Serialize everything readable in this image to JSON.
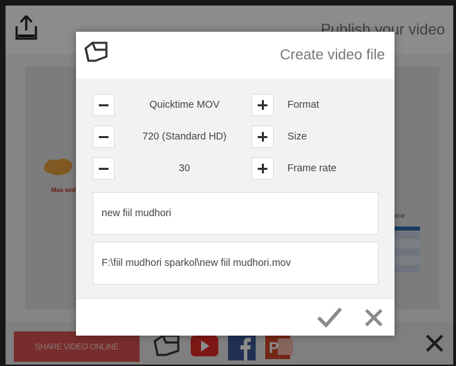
{
  "window": {
    "title": "Publish your video",
    "icon": "upload-icon"
  },
  "background": {
    "red_text": "Mas sedi",
    "table_label": "penar"
  },
  "footer": {
    "share_label": "SHARE VIDEO ONLINE",
    "icons": [
      "sparkol-icon",
      "youtube-icon",
      "facebook-icon",
      "powerpoint-icon",
      "close-icon"
    ]
  },
  "dialog": {
    "title": "Create video file",
    "logo": "sparkol-logo-icon",
    "options": [
      {
        "value": "Quicktime MOV",
        "label": "Format"
      },
      {
        "value": "720 (Standard HD)",
        "label": "Size"
      },
      {
        "value": "30",
        "label": "Frame rate"
      }
    ],
    "file_name": "new fiil mudhori",
    "file_path": "F:\\fiil mudhori sparkol\\new fiil mudhori.mov",
    "ok_icon": "checkmark-icon",
    "cancel_icon": "close-icon"
  },
  "colors": {
    "share_button": "#d9534f",
    "youtube": "#e52d27",
    "facebook": "#3b5998",
    "powerpoint": "#d24726"
  }
}
